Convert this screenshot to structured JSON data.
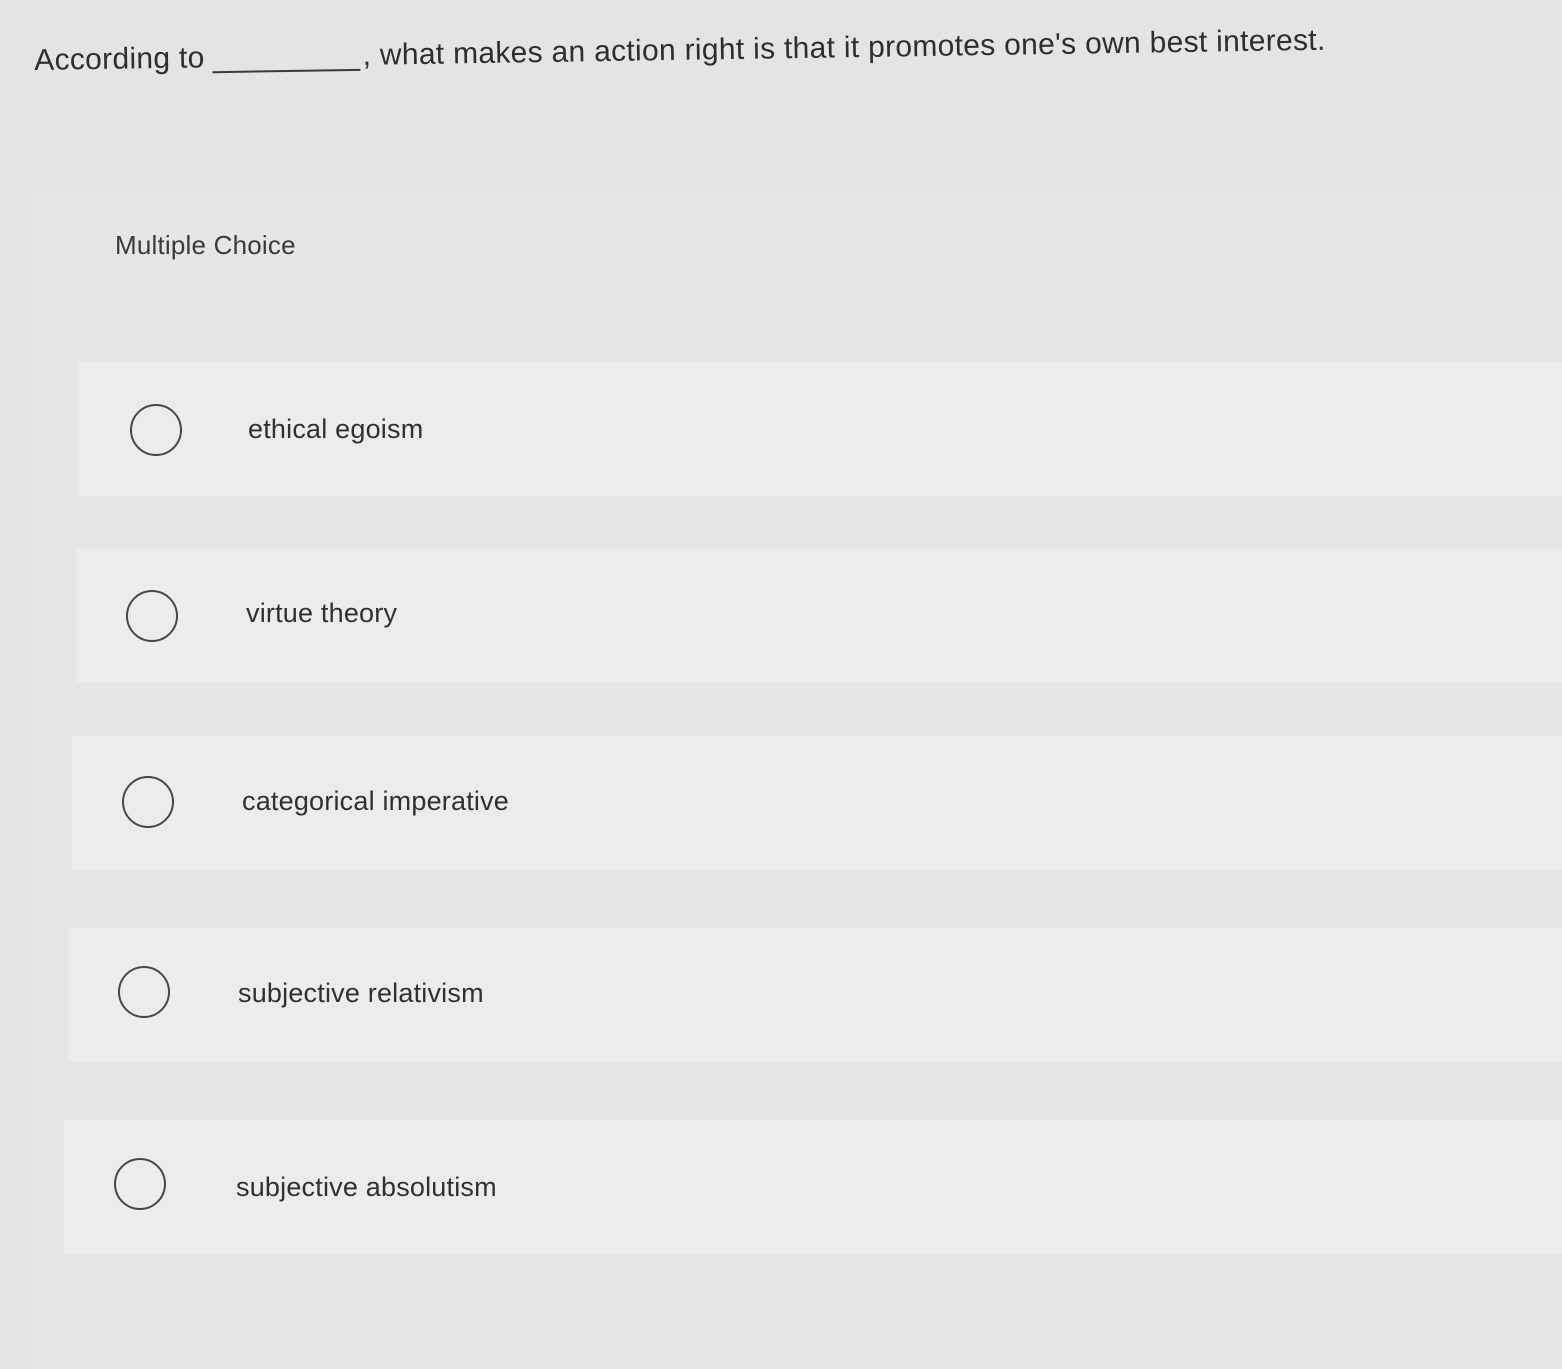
{
  "question": {
    "prefix": "According to",
    "suffix": ", what makes an action right is that it promotes one's own best interest."
  },
  "multiple_choice": {
    "header": "Multiple Choice",
    "options": [
      {
        "label": "ethical egoism",
        "selected": false
      },
      {
        "label": "virtue theory",
        "selected": false
      },
      {
        "label": "categorical imperative",
        "selected": false
      },
      {
        "label": "subjective relativism",
        "selected": false
      },
      {
        "label": "subjective absolutism",
        "selected": false
      }
    ]
  }
}
